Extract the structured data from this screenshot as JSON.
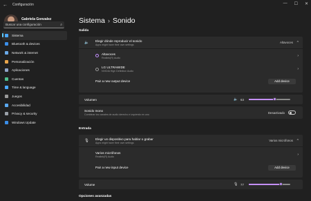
{
  "window": {
    "title": "Configuración",
    "back_glyph": "←",
    "minimize": "—",
    "maximize": "☐",
    "close": "✕"
  },
  "profile": {
    "name": "Gabriela Gonzalez"
  },
  "search": {
    "placeholder": "Buscar una configuración",
    "icon": "⌕"
  },
  "sidebar": {
    "items": [
      {
        "label": "Sistema",
        "color": "#4aa8ff"
      },
      {
        "label": "Bluetooth & devices",
        "color": "#3b8ee8"
      },
      {
        "label": "Network & internet",
        "color": "#6aa9e8"
      },
      {
        "label": "Personalización",
        "color": "#e8a54b"
      },
      {
        "label": "Aplicaciones",
        "color": "#8fa4c8"
      },
      {
        "label": "Cuentas",
        "color": "#4fc08d"
      },
      {
        "label": "Time & language",
        "color": "#4aa8ff"
      },
      {
        "label": "Juegos",
        "color": "#9a9a9a"
      },
      {
        "label": "Accesibilidad",
        "color": "#5aa9f0"
      },
      {
        "label": "Privacy & security",
        "color": "#9aa0a8"
      },
      {
        "label": "Windows Update",
        "color": "#3b8ee8"
      }
    ]
  },
  "breadcrumb": {
    "parent": "Sistema",
    "sep": "›",
    "current": "Sonido"
  },
  "output": {
    "section_title": "Salida",
    "choose": {
      "title": "Elegir dónde reproducir el sonido",
      "subtitle": "Apps might have their own settings",
      "value": "Altavoces",
      "chev": "^"
    },
    "devices": [
      {
        "name": "Altavoces",
        "sub": "Realtek(R) Audio",
        "selected": true
      },
      {
        "name": "LG ULTRAWIDE",
        "sub": "NVIDIA High Definition Audio",
        "selected": false
      }
    ],
    "pair_label": "Pair a new output device",
    "add_label": "Add device",
    "volume": {
      "label": "Volumen",
      "value": "63",
      "level": 0.63
    },
    "mono": {
      "title": "Sonido mono",
      "subtitle": "Combinar los canales de audio derecho e izquierdo en uno",
      "state": "Desactivado"
    }
  },
  "input": {
    "section_title": "Entrada",
    "choose": {
      "title": "Elegir un dispositivo para hablar o grabar",
      "subtitle": "Apps might have their own settings",
      "value": "Varios micrófonos",
      "chev": "^"
    },
    "device": {
      "name": "Varios micrófonos",
      "sub": "Realtek(R) Audio"
    },
    "pair_label": "Pair a new input device",
    "add_label": "Add device",
    "volume": {
      "label": "Volume",
      "value": "77",
      "level": 0.77
    }
  },
  "advanced": {
    "title": "Opciones avanzadas"
  },
  "glyphs": {
    "chevron_right": "›",
    "speaker": "🔈",
    "mic": "🎙"
  },
  "accent": "#c590ff"
}
